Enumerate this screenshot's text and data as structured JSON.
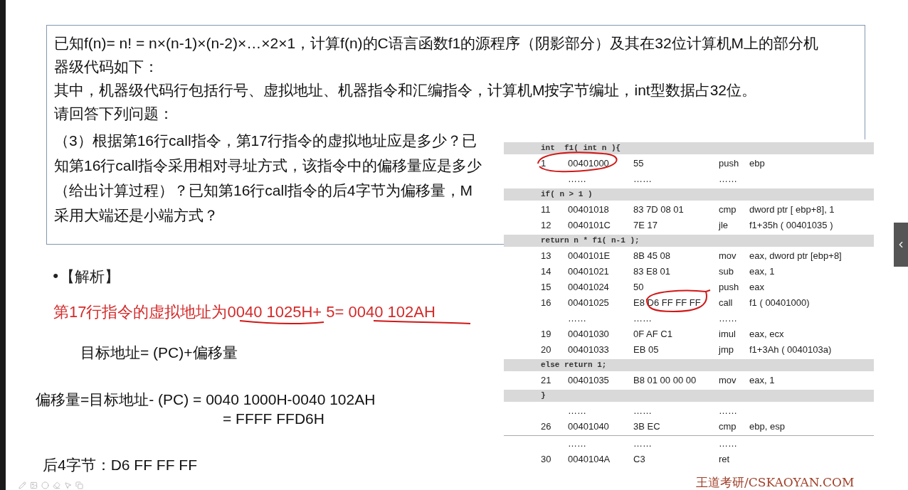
{
  "question": {
    "paragraphs": [
      "已知f(n)= n! = n×(n-1)×(n-2)×…×2×1，计算f(n)的C语言函数f1的源程序（阴影部分）及其在32位计算机M上的部分机器级代码如下：",
      "其中，机器级代码行包括行号、虚拟地址、机器指令和汇编指令，计算机M按字节编址，int型数据占32位。",
      "请回答下列问题："
    ],
    "sub_question": "（3）根据第16行call指令，第17行指令的虚拟地址应是多少？已知第16行call指令采用相对寻址方式，该指令中的偏移量应是多少（给出计算过程）？已知第16行call指令的后4字节为偏移量，M采用大端还是小端方式？"
  },
  "code_table": {
    "rows": [
      {
        "kind": "source",
        "text": "int  f1( int n ){"
      },
      {
        "kind": "instr",
        "line": "1",
        "address": "00401000",
        "bytes": "55",
        "mnemonic": "push",
        "operands": "ebp"
      },
      {
        "kind": "dots",
        "cells": [
          "……",
          "……",
          "……"
        ]
      },
      {
        "kind": "source",
        "text": "if( n > 1 )"
      },
      {
        "kind": "instr",
        "line": "11",
        "address": "00401018",
        "bytes": "83 7D 08 01",
        "mnemonic": "cmp",
        "operands": "dword ptr [ ebp+8], 1"
      },
      {
        "kind": "instr",
        "line": "12",
        "address": "0040101C",
        "bytes": "7E 17",
        "mnemonic": "jle",
        "operands": "f1+35h ( 00401035 )"
      },
      {
        "kind": "source",
        "text": "return n * f1( n-1 );"
      },
      {
        "kind": "instr",
        "line": "13",
        "address": "0040101E",
        "bytes": "8B 45 08",
        "mnemonic": "mov",
        "operands": "eax, dword ptr [ebp+8]"
      },
      {
        "kind": "instr",
        "line": "14",
        "address": "00401021",
        "bytes": "83 E8 01",
        "mnemonic": "sub",
        "operands": "eax, 1"
      },
      {
        "kind": "instr",
        "line": "15",
        "address": "00401024",
        "bytes": "50",
        "mnemonic": "push",
        "operands": "eax"
      },
      {
        "kind": "instr",
        "line": "16",
        "address": "00401025",
        "bytes": "E8 D6 FF FF FF",
        "mnemonic": "call",
        "operands": "f1 ( 00401000)"
      },
      {
        "kind": "dots",
        "cells": [
          "……",
          "……",
          "……"
        ]
      },
      {
        "kind": "instr",
        "line": "19",
        "address": "00401030",
        "bytes": "0F AF C1",
        "mnemonic": "imul",
        "operands": "eax, ecx"
      },
      {
        "kind": "instr",
        "line": "20",
        "address": "00401033",
        "bytes": "EB 05",
        "mnemonic": "jmp",
        "operands": "f1+3Ah ( 0040103a)"
      },
      {
        "kind": "source",
        "text": "else return 1;"
      },
      {
        "kind": "instr",
        "line": "21",
        "address": "00401035",
        "bytes": "B8 01 00 00 00",
        "mnemonic": "mov",
        "operands": "eax, 1"
      },
      {
        "kind": "source",
        "text": "}"
      },
      {
        "kind": "dots",
        "cells": [
          "……",
          "……",
          "……"
        ]
      },
      {
        "kind": "instr",
        "line": "26",
        "address": "00401040",
        "bytes": "3B EC",
        "mnemonic": "cmp",
        "operands": "ebp, esp"
      },
      {
        "kind": "dots",
        "cells": [
          "……",
          "……",
          "……"
        ]
      },
      {
        "kind": "instr",
        "line": "30",
        "address": "0040104A",
        "bytes": "C3",
        "mnemonic": "ret",
        "operands": ""
      }
    ]
  },
  "analysis": {
    "heading": "•【解析】",
    "answer": "第17行指令的虚拟地址为0040 1025H+ 5= 0040 102AH",
    "formula": "目标地址= (PC)+偏移量",
    "offset_line_1": "偏移量=目标地址- (PC) = 0040 1000H-0040 102AH",
    "offset_line_2": "= FFFF FFD6H",
    "last_bytes": "后4字节：D6 FF FF FF"
  },
  "footer": "王道考研/CSKAOYAN.COM"
}
